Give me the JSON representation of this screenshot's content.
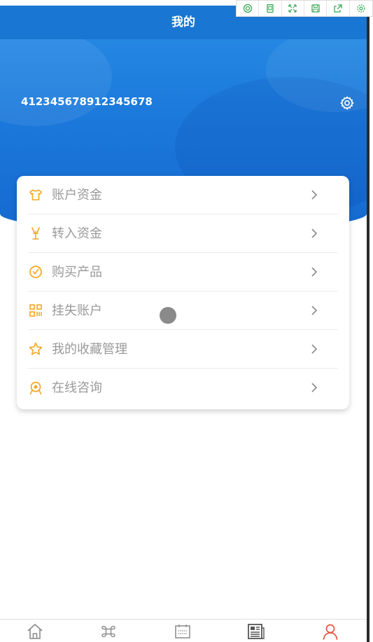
{
  "header": {
    "title": "我的"
  },
  "account": {
    "id": "412345678912345678"
  },
  "menu": {
    "items": [
      {
        "label": "账户资金",
        "icon": "shirt-icon"
      },
      {
        "label": "转入资金",
        "icon": "transfer-icon"
      },
      {
        "label": "购买产品",
        "icon": "clock-check-icon"
      },
      {
        "label": "挂失账户",
        "icon": "qr-grid-icon"
      },
      {
        "label": "我的收藏管理",
        "icon": "star-icon"
      },
      {
        "label": "在线咨询",
        "icon": "support-icon"
      }
    ]
  },
  "toolbar": {
    "icons": [
      "screenshot-icon",
      "device-icon",
      "fullscreen-icon",
      "save-icon",
      "share-icon",
      "settings-icon"
    ]
  },
  "tabbar": {
    "tabs": [
      {
        "name": "home-tab",
        "icon": "home-icon",
        "active": false
      },
      {
        "name": "category-tab",
        "icon": "command-icon",
        "active": false
      },
      {
        "name": "calendar-tab",
        "icon": "calendar-icon",
        "active": false
      },
      {
        "name": "news-tab",
        "icon": "newspaper-icon",
        "active": false
      },
      {
        "name": "profile-tab",
        "icon": "user-icon",
        "active": true
      }
    ]
  },
  "colors": {
    "brand_blue": "#1976d2",
    "icon_orange": "#f5a623",
    "active_tab": "#e8553d",
    "inactive_tab": "#8a8a8a"
  }
}
